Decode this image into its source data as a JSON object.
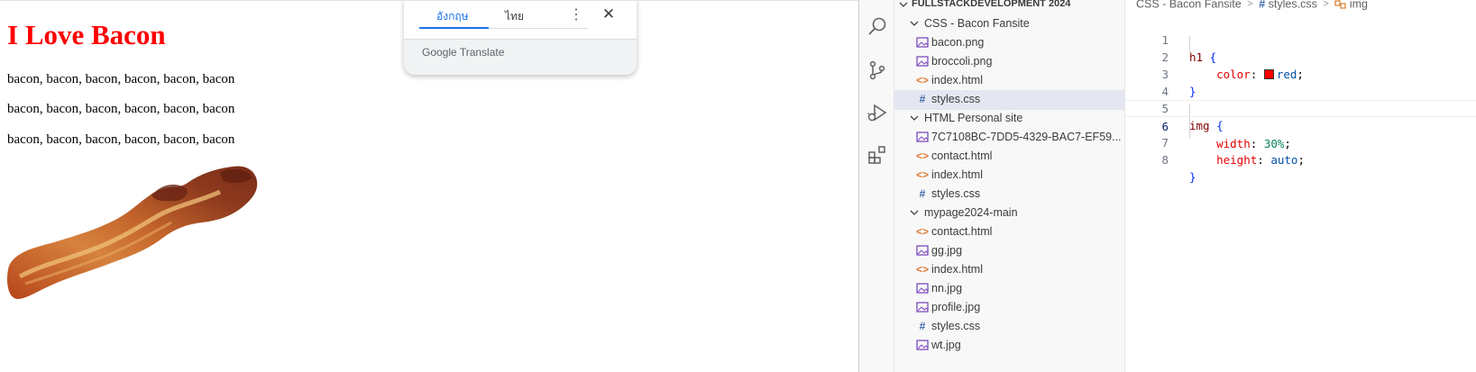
{
  "preview": {
    "heading": "I Love Bacon",
    "paragraphs": [
      "bacon, bacon, bacon, bacon, bacon, bacon",
      "bacon, bacon, bacon, bacon, bacon, bacon",
      "bacon, bacon, bacon, bacon, bacon, bacon"
    ],
    "heading_color": "#ff0000"
  },
  "translate": {
    "tabs": [
      "อังกฤษ",
      "ไทย"
    ],
    "brand_google": "Google",
    "brand_translate": "Translate",
    "more_icon": "⋮",
    "close_icon": "✕"
  },
  "activity_bar": [
    "search-icon",
    "source-control-icon",
    "run-debug-icon",
    "extensions-icon"
  ],
  "explorer": {
    "title": "FULLSTACKDEVELOPMENT 2024",
    "items": [
      {
        "label": "CSS - Bacon Fansite",
        "type": "folder"
      },
      {
        "label": "bacon.png",
        "type": "image"
      },
      {
        "label": "broccoli.png",
        "type": "image"
      },
      {
        "label": "index.html",
        "type": "html"
      },
      {
        "label": "styles.css",
        "type": "css",
        "selected": true
      },
      {
        "label": "HTML Personal site",
        "type": "folder"
      },
      {
        "label": "7C7108BC-7DD5-4329-BAC7-EF59...",
        "type": "image"
      },
      {
        "label": "contact.html",
        "type": "html"
      },
      {
        "label": "index.html",
        "type": "html"
      },
      {
        "label": "styles.css",
        "type": "css"
      },
      {
        "label": "mypage2024-main",
        "type": "folder"
      },
      {
        "label": "contact.html",
        "type": "html"
      },
      {
        "label": "gg.jpg",
        "type": "image"
      },
      {
        "label": "index.html",
        "type": "html"
      },
      {
        "label": "nn.jpg",
        "type": "image"
      },
      {
        "label": "profile.jpg",
        "type": "image"
      },
      {
        "label": "styles.css",
        "type": "css"
      },
      {
        "label": "wt.jpg",
        "type": "image"
      }
    ]
  },
  "breadcrumb": {
    "folder": "CSS - Bacon Fansite",
    "hash": "#",
    "file": "styles.css",
    "symbol": "img"
  },
  "editor": {
    "current_line": 6,
    "line_numbers": [
      "1",
      "2",
      "3",
      "4",
      "5",
      "6",
      "7",
      "8"
    ],
    "tokens": {
      "sel_h1": "h1",
      "open1": " {",
      "prop_color": "color",
      "colon1": ": ",
      "val_red": "red",
      "semi1": ";",
      "close1": "}",
      "sel_img": "img",
      "open2": " {",
      "prop_width": "width",
      "colon2": ": ",
      "num_30": "30%",
      "semi2": ";",
      "prop_height": "height",
      "colon3": ": ",
      "val_auto": "auto",
      "semi3": ";",
      "close2": "}"
    }
  }
}
